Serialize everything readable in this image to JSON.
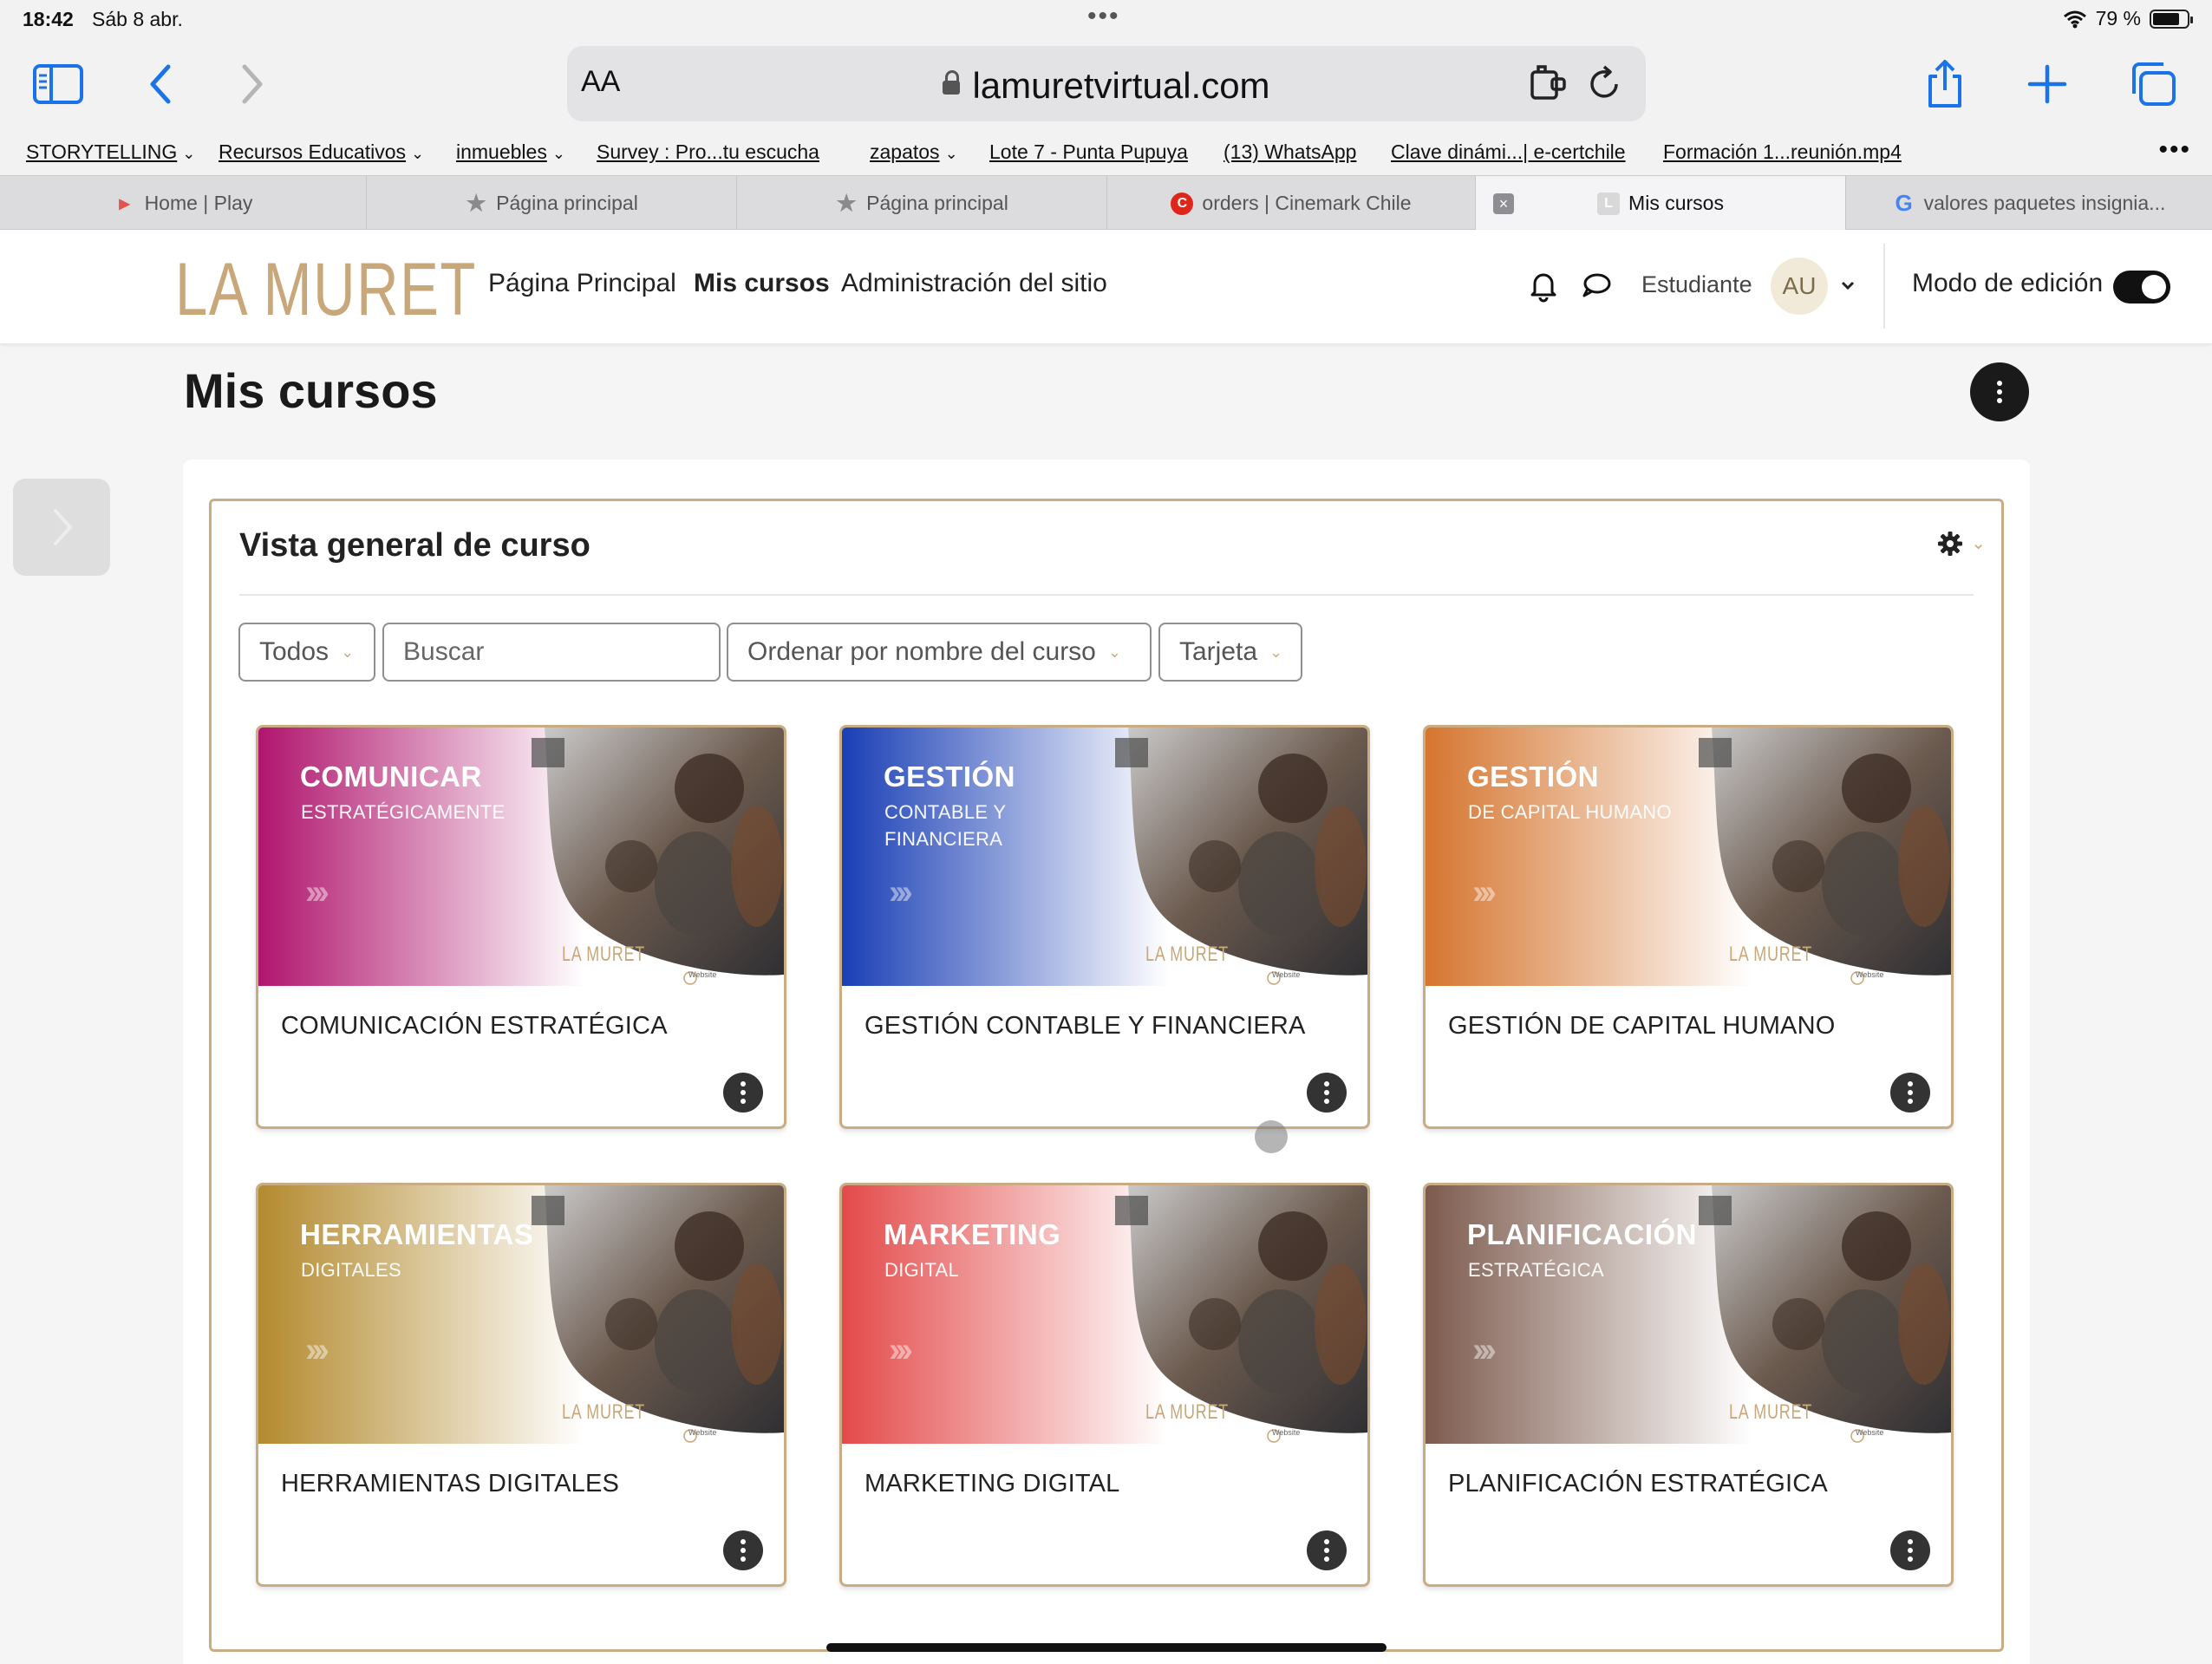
{
  "status": {
    "time": "18:42",
    "date": "Sáb 8 abr.",
    "battery": "79 %"
  },
  "browser": {
    "aa_label": "AA",
    "url": "lamuretvirtual.com",
    "bookmarks": [
      {
        "label": "STORYTELLING",
        "dropdown": true
      },
      {
        "label": "Recursos Educativos",
        "dropdown": true
      },
      {
        "label": "inmuebles",
        "dropdown": true
      },
      {
        "label": "Survey : Pro...tu escucha",
        "dropdown": false
      },
      {
        "label": "zapatos",
        "dropdown": true
      },
      {
        "label": "Lote 7 - Punta Pupuya",
        "dropdown": false
      },
      {
        "label": "(13) WhatsApp",
        "dropdown": false
      },
      {
        "label": "Clave dinámi...| e-certchile",
        "dropdown": false
      },
      {
        "label": "Formación 1...reunión.mp4",
        "dropdown": false
      }
    ],
    "tabs": [
      {
        "label": "Home | Play",
        "icon": "play-icon",
        "active": false
      },
      {
        "label": "Página principal",
        "icon": "star-icon",
        "active": false
      },
      {
        "label": "Página principal",
        "icon": "star-icon",
        "active": false
      },
      {
        "label": "orders | Cinemark Chile",
        "icon": "cinemark-icon",
        "active": false
      },
      {
        "label": "Mis cursos",
        "icon": "site-icon",
        "active": true
      },
      {
        "label": "valores paquetes insignia...",
        "icon": "google-icon",
        "active": false
      }
    ]
  },
  "site": {
    "logo": "LA MURET",
    "nav": [
      "Página Principal",
      "Mis cursos",
      "Administración del sitio"
    ],
    "role": "Estudiante",
    "avatar": "AU",
    "edit_mode_label": "Modo de edición",
    "edit_mode_on": true
  },
  "page": {
    "title": "Mis cursos",
    "block_title": "Vista general de curso",
    "filter_value": "Todos",
    "search_placeholder": "Buscar",
    "sort_value": "Ordenar por nombre del curso",
    "view_value": "Tarjeta"
  },
  "colors": {
    "accent": "#c8ad84",
    "logo": "#c8a77a"
  },
  "courses": [
    {
      "name": "COMUNICACIÓN ESTRATÉGICA",
      "cover_title": "COMUNICAR",
      "cover_sub": [
        "ESTRATÉGICAMENTE"
      ],
      "cover_logo": "LA MURET",
      "cover_web": "Website",
      "color": "#b0156d"
    },
    {
      "name": "GESTIÓN CONTABLE Y FINANCIERA",
      "cover_title": "GESTIÓN",
      "cover_sub": [
        "CONTABLE Y",
        "FINANCIERA"
      ],
      "cover_logo": "LA MURET",
      "cover_web": "Website",
      "color": "#1a3fb5"
    },
    {
      "name": "GESTIÓN DE CAPITAL HUMANO",
      "cover_title": "GESTIÓN",
      "cover_sub": [
        "DE CAPITAL HUMANO"
      ],
      "cover_logo": "LA MURET",
      "cover_web": "Website",
      "color": "#d5752f"
    },
    {
      "name": "HERRAMIENTAS DIGITALES",
      "cover_title": "HERRAMIENTAS",
      "cover_sub": [
        "DIGITALES"
      ],
      "cover_logo": "LA MURET",
      "cover_web": "Website",
      "color": "#b38a2e"
    },
    {
      "name": "MARKETING DIGITAL",
      "cover_title": "MARKETING",
      "cover_sub": [
        "DIGITAL"
      ],
      "cover_logo": "LA MURET",
      "cover_web": "Website",
      "color": "#e44a4a"
    },
    {
      "name": "PLANIFICACIÓN ESTRATÉGICA",
      "cover_title": "PLANIFICACIÓN",
      "cover_sub": [
        "ESTRATÉGICA"
      ],
      "cover_logo": "LA MURET",
      "cover_web": "Website",
      "color": "#7d5b4e"
    }
  ]
}
